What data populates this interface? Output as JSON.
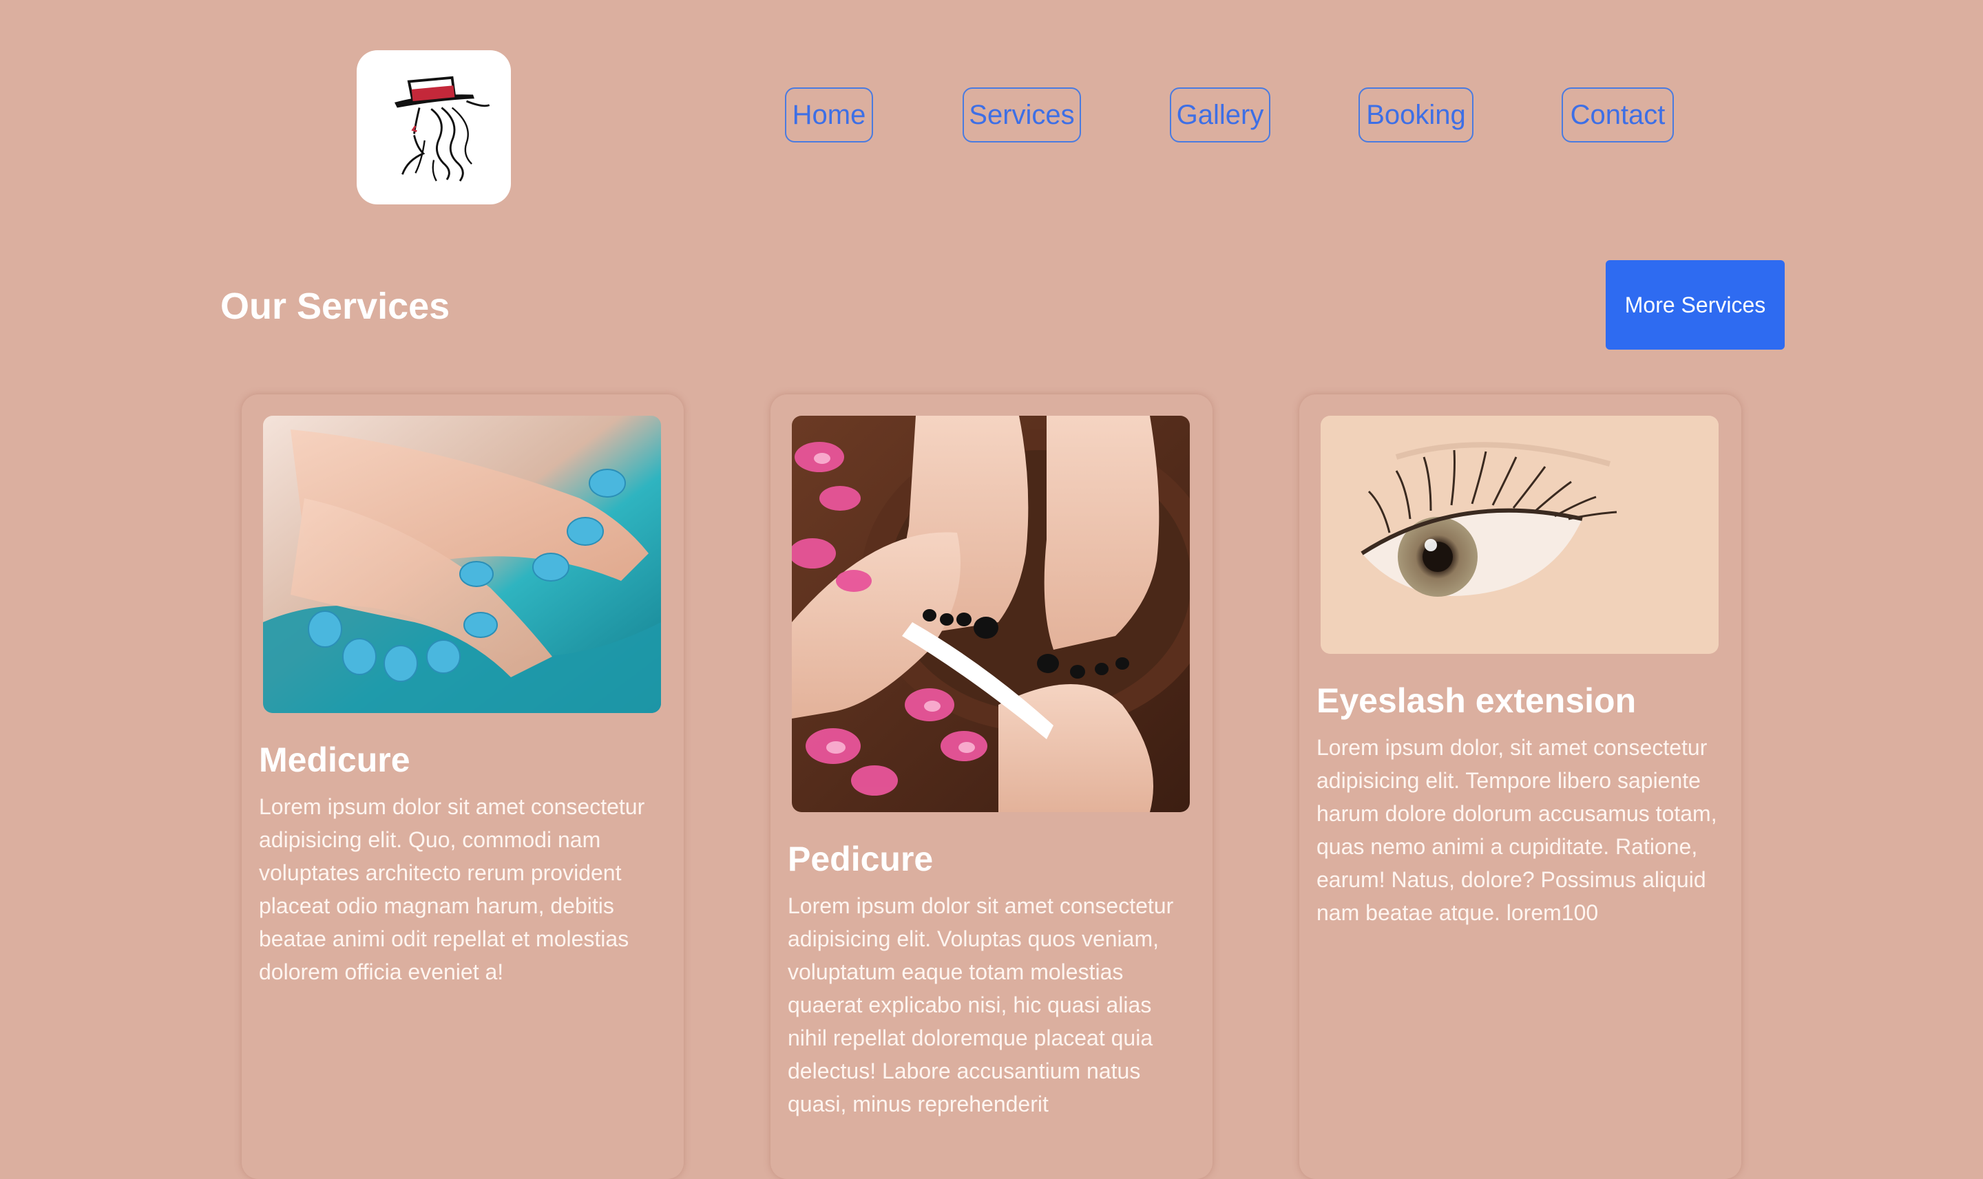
{
  "brand": {
    "logo_icon": "woman-with-hat-logo"
  },
  "nav": {
    "items": [
      {
        "label": "Home"
      },
      {
        "label": "Services"
      },
      {
        "label": "Gallery"
      },
      {
        "label": "Booking"
      },
      {
        "label": "Contact"
      }
    ],
    "link_color": "#3d6fe6"
  },
  "services": {
    "title": "Our Services",
    "more_button": "More Services",
    "cards": [
      {
        "title": "Medicure",
        "image_icon": "manicure-hands-image",
        "text": "Lorem ipsum dolor sit amet consectetur adipisicing elit. Quo, commodi nam voluptates architecto rerum provident placeat odio magnam harum, debitis beatae animi odit repellat et molestias dolorem officia eveniet a!"
      },
      {
        "title": "Pedicure",
        "image_icon": "pedicure-feet-image",
        "text": "Lorem ipsum dolor sit amet consectetur adipisicing elit. Voluptas quos veniam, voluptatum eaque totam molestias quaerat explicabo nisi, hic quasi alias nihil repellat doloremque placeat quia delectus! Labore accusantium natus quasi, minus reprehenderit"
      },
      {
        "title": "Eyeslash extension",
        "image_icon": "eyelash-eye-image",
        "text": "Lorem ipsum dolor, sit amet consectetur adipisicing elit. Tempore libero sapiente harum dolore dolorum accusamus totam, quas nemo animi a cupiditate. Ratione, earum! Natus, dolore? Possimus aliquid nam beatae atque. lorem100"
      }
    ]
  },
  "colors": {
    "background": "#dbaf9f",
    "accent": "#2e6bf1"
  }
}
